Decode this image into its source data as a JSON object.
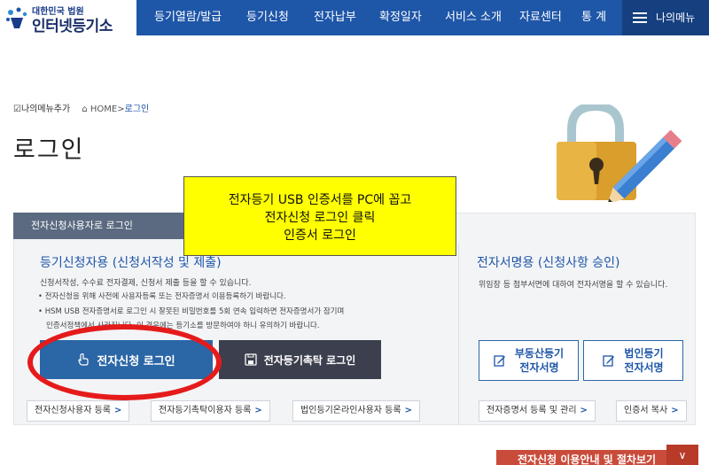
{
  "header": {
    "logo_small": "대한민국 법원",
    "logo_big": "인터넷등기소",
    "nav": [
      "등기열람/발급",
      "등기신청",
      "전자납부",
      "확정일자",
      "서비스 소개",
      "자료센터",
      "통 계"
    ],
    "my_menu": "나의메뉴"
  },
  "breadcrumb": {
    "add_menu": "나의메뉴추가",
    "home": "HOME",
    "separator": ">",
    "current": "로그인"
  },
  "page": {
    "title": "로그인"
  },
  "panel": {
    "tab_label": "전자신청사용자로 로그인",
    "left": {
      "title": "등기신청자용 (신청서작성 및 제출)",
      "desc": "신청서작성, 수수료 전자결제, 신청서 제출 등을 할 수 있습니다.",
      "bullets": [
        "• 전자신청을 위해 사전에 사용자등록 또는 전자증명서 이용등록하기 바랍니다.",
        "• HSM USB 전자증명서로 로그인 시 잘못된 비밀번호를 5회 연속 입력하면 전자증명서가 잠기며",
        "  인증서정책에서 사라집니다. 이 경우에는 등기소를 방문하여야 하니 유의하기 바랍니다."
      ],
      "login_button": "전자신청 로그인",
      "trust_button": "전자등기촉탁 로그인"
    },
    "right": {
      "title": "전자서명용 (신청사항 승인)",
      "desc": "위임장 등 첨부서면에 대하여 전자서명을 할 수 있습니다.",
      "sign_buttons": [
        {
          "line1": "부동산등기",
          "line2": "전자서명"
        },
        {
          "line1": "법인등기",
          "line2": "전자서명"
        }
      ]
    },
    "links": [
      {
        "label": "전자신청사용자 등록",
        "arrow": ">"
      },
      {
        "label": "전자등기촉탁이용자 등록",
        "arrow": ">"
      },
      {
        "label": "법인등기온라인사용자 등록",
        "arrow": ">"
      },
      {
        "label": "전자증명서 등록 및 관리",
        "arrow": ">"
      },
      {
        "label": "인증서 복사",
        "arrow": ">"
      }
    ]
  },
  "guide": {
    "label": "전자신청 이용안내 및 절차보기",
    "chevron": "∨"
  },
  "annotation": {
    "lines": [
      "전자등기 USB 인증서를 PC에 꼽고",
      "전자신청 로그인 클릭",
      "인증서 로그인"
    ]
  },
  "colors": {
    "nav_bg": "#1e56a8",
    "login_button": "#2b66a6",
    "trust_button": "#3c3f4d",
    "callout": "#ffff00",
    "ellipse": "#e51b1b",
    "guide_bar": "#c94c3b"
  }
}
